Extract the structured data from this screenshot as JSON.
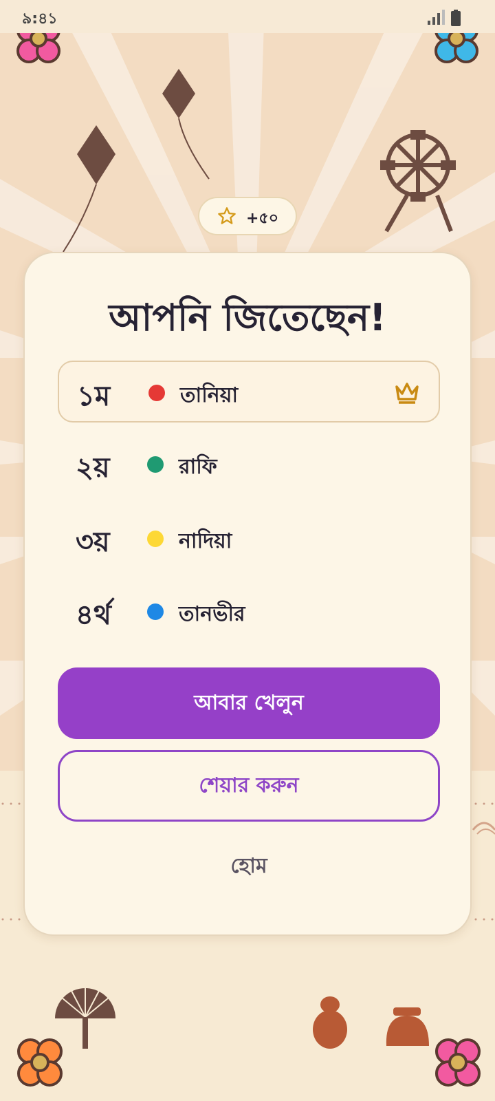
{
  "status_bar": {
    "time": "৯:৪১"
  },
  "reward": {
    "label": "+৫০"
  },
  "result": {
    "title": "আপনি জিতেছেন!"
  },
  "standings": [
    {
      "rank": "১ম",
      "name": "তানিয়া",
      "color": "#e53935",
      "winner": true
    },
    {
      "rank": "২য়",
      "name": "রাফি",
      "color": "#1f9a72"
    },
    {
      "rank": "৩য়",
      "name": "নাদিয়া",
      "color": "#fdd835"
    },
    {
      "rank": "৪র্থ",
      "name": "তানভীর",
      "color": "#1e88e5"
    }
  ],
  "actions": {
    "play_again": "আবার খেলুন",
    "share": "শেয়ার করুন",
    "home": "হোম"
  },
  "colors": {
    "accent": "#9540c8",
    "background": "#f3dcc2",
    "card": "#fdf6e7"
  }
}
